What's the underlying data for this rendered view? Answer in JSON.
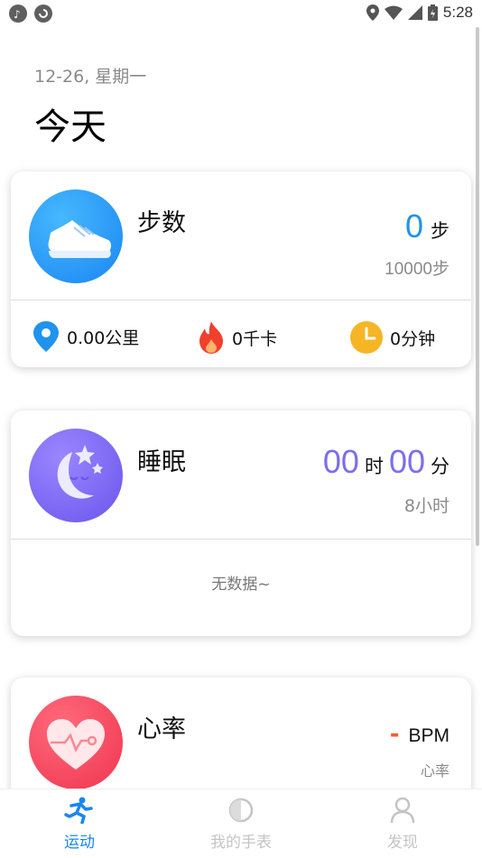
{
  "status_bar": {
    "time": "5:28"
  },
  "header": {
    "date": "12-26, 星期一",
    "title": "今天"
  },
  "steps_card": {
    "name": "步数",
    "value": "0",
    "unit": "步",
    "goal": "10000步",
    "distance": "0.00公里",
    "calories": "0千卡",
    "duration": "0分钟"
  },
  "sleep_card": {
    "name": "睡眠",
    "hours": "00",
    "hours_unit": "时",
    "minutes": "00",
    "minutes_unit": "分",
    "goal": "8小时",
    "empty_text": "无数据~"
  },
  "heart_card": {
    "name": "心率",
    "value": "-",
    "unit": "BPM",
    "label": "心率"
  },
  "bottom_nav": {
    "items": [
      {
        "label": "运动",
        "icon": "running-icon",
        "active": true
      },
      {
        "label": "我的手表",
        "icon": "watch-icon",
        "active": false
      },
      {
        "label": "发现",
        "icon": "person-icon",
        "active": false
      }
    ]
  },
  "colors": {
    "accent_blue": "#1f93ee",
    "accent_purple": "#7b6ef0",
    "accent_red": "#ef3550",
    "dash_orange": "#ff5a2a"
  }
}
